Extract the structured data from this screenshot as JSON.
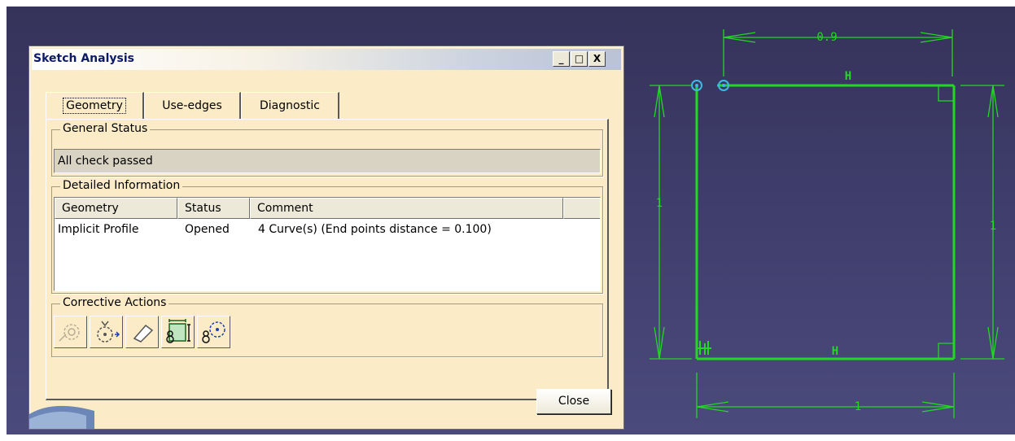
{
  "dialog": {
    "title": "Sketch Analysis",
    "window_buttons": {
      "minimize": "_",
      "maximize": "□",
      "close": "X"
    },
    "tabs": [
      {
        "label": "Geometry",
        "active": true
      },
      {
        "label": "Use-edges",
        "active": false
      },
      {
        "label": "Diagnostic",
        "active": false
      }
    ],
    "general_status": {
      "label": "General Status",
      "value": "All check passed"
    },
    "detailed_information": {
      "label": "Detailed Information",
      "columns": [
        "Geometry",
        "Status",
        "Comment"
      ],
      "rows": [
        {
          "geometry": "Implicit Profile",
          "status": "Opened",
          "comment": "4 Curve(s) (End points distance = 0.100)"
        }
      ]
    },
    "corrective_actions": {
      "label": "Corrective Actions",
      "buttons": [
        {
          "icon": "close-open-profile-icon",
          "enabled": false
        },
        {
          "icon": "rotate-move-icon",
          "enabled": true
        },
        {
          "icon": "erase-icon",
          "enabled": true
        },
        {
          "icon": "hide-constraints-icon",
          "enabled": true
        },
        {
          "icon": "hide-construction-icon",
          "enabled": true
        }
      ]
    },
    "close_label": "Close"
  },
  "sketch": {
    "line_color": "#22d822",
    "dimensions": {
      "top": "0.9",
      "bottom": "1",
      "left": "1",
      "right": "1"
    },
    "constraint_labels": {
      "top_horizontal": "H",
      "bottom_horizontal": "H"
    }
  }
}
